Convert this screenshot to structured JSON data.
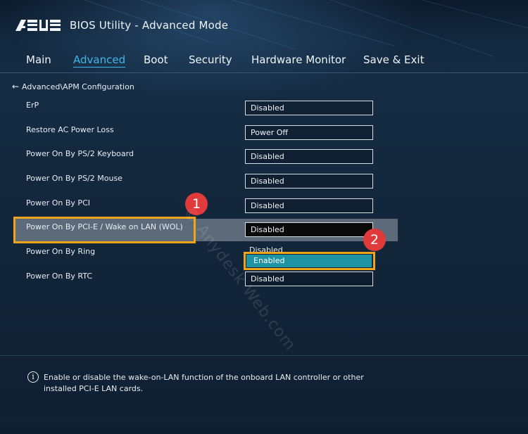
{
  "app": {
    "logo_text": "ASUS",
    "title": "BIOS Utility - Advanced Mode"
  },
  "tabs": [
    {
      "label": "Main",
      "active": false
    },
    {
      "label": "Advanced",
      "active": true
    },
    {
      "label": "Boot",
      "active": false
    },
    {
      "label": "Security",
      "active": false
    },
    {
      "label": "Hardware Monitor",
      "active": false
    },
    {
      "label": "Save & Exit",
      "active": false
    }
  ],
  "breadcrumb": {
    "back_icon": "left-arrow-icon",
    "path": "Advanced\\APM Configuration"
  },
  "settings": [
    {
      "label": "ErP",
      "value": "Disabled"
    },
    {
      "label": "Restore AC Power Loss",
      "value": "Power Off"
    },
    {
      "label": "Power On By PS/2 Keyboard",
      "value": "Disabled"
    },
    {
      "label": "Power On By PS/2 Mouse",
      "value": "Disabled"
    },
    {
      "label": "Power On By PCI",
      "value": "Disabled"
    },
    {
      "label": "Power On By PCI-E / Wake on LAN (WOL)",
      "value": "Disabled"
    },
    {
      "label": "Power On By Ring",
      "value": ""
    },
    {
      "label": "Power On By RTC",
      "value": "Disabled"
    }
  ],
  "dropdown": {
    "options": [
      "Disabled",
      "Enabled"
    ],
    "highlighted": "Enabled"
  },
  "annotations": {
    "step1": "1",
    "step2": "2"
  },
  "watermark": "© Anydesk Web.com",
  "help": {
    "icon": "info-icon",
    "text": "Enable or disable the wake-on-LAN function of the onboard LAN controller or other installed PCI-E LAN cards."
  },
  "colors": {
    "accent": "#41b7e8",
    "highlight_border": "#f0a418",
    "badge": "#e03a3a",
    "selected_option": "#1e93a3"
  }
}
